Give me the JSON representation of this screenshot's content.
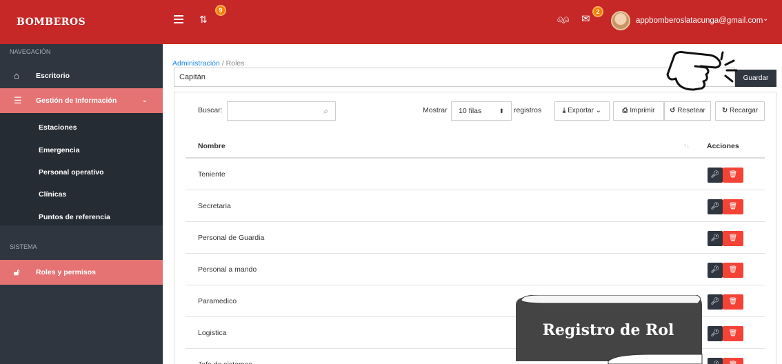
{
  "brand": "BOMBEROS",
  "topbar": {
    "notif_count": "9",
    "chat_count": "2",
    "user_email": "appbomberoslatacunga@gmail.com"
  },
  "sidebar": {
    "nav_label": "NAVEGACIÓN",
    "system_label": "SISTEMA",
    "items": {
      "escritorio": "Escritorio",
      "gestion": "Gestión de Información",
      "roles": "Roles y permisos"
    },
    "sub_items": [
      "Estaciones",
      "Emergencia",
      "Personal operativo",
      "Clínicas",
      "Puntos de referencia"
    ]
  },
  "breadcrumb": {
    "parent": "Administración",
    "separator": "/",
    "current": "Roles"
  },
  "form": {
    "name_value": "Capitán",
    "save_label": "Guardar"
  },
  "table_controls": {
    "search_label": "Buscar:",
    "show_label": "Mostrar",
    "rows_selected": "10 filas",
    "records_label": "registros",
    "export_label": "Exportar",
    "print_label": "Imprimir",
    "reset_label": "Resetear",
    "reload_label": "Recargar"
  },
  "table": {
    "headers": {
      "name": "Nombre",
      "actions": "Acciones"
    },
    "rows": [
      "Teniente",
      "Secretaria",
      "Personal de Guardia",
      "Personal a mando",
      "Paramedico",
      "Logistica",
      "Jefa de sistemas"
    ]
  },
  "overlay": {
    "callout_text": "Registro de Rol"
  },
  "colors": {
    "primary": "#c62828",
    "sidebar": "#2f3640",
    "active": "#e57373",
    "danger": "#f44336",
    "link": "#1e88e5"
  }
}
